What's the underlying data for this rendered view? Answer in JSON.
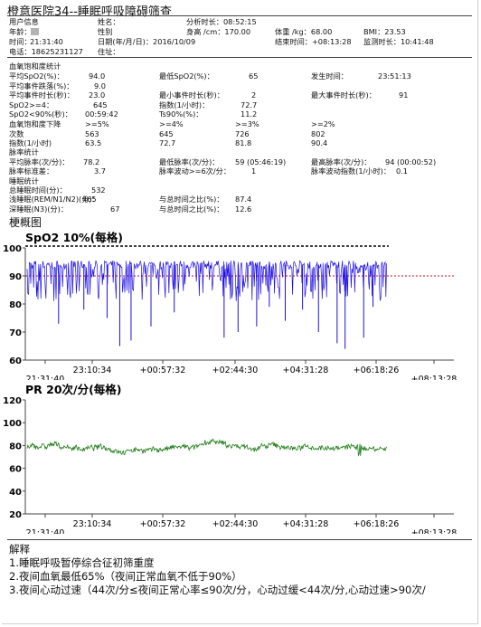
{
  "title": "橙意医院34--睡眠呼吸障碍筛查",
  "patient": {
    "user_info": "用户信息",
    "name_label": "姓名：",
    "analysis_duration": "分析时长：08:52:15",
    "age_label": "年龄：",
    "gender_label": "性别",
    "height": "身高 /cm：170.00",
    "weight": "体重 /kg：68.00",
    "bmi": "BMI：23.53",
    "time_label": "时间：",
    "time_value": "21:31:40",
    "date": "日期(年/月/日)：2016/10/09",
    "end_time": "结束时间：+08:13:28",
    "monitor_duration": "监测时长：10:41:48",
    "phone": "电话：18625231127",
    "address": "住址："
  },
  "spo2_stats": {
    "heading": "血氧饱和度统计",
    "rows": [
      {
        "label": "平均SpO2(%)：",
        "value": "94.0",
        "label2": "最低SpO2(%)：",
        "value2": "65",
        "label3": "发生时间：",
        "value3": "23:51:13"
      },
      {
        "label": "平均事件跌落(%)：",
        "value": "9.0"
      },
      {
        "label": "平均事件时长(秒)：",
        "value": "23.0",
        "label2": "最小事件时长(秒)：",
        "value2": "2",
        "label3": "最大事件时长(秒)：",
        "value3": "91"
      },
      {
        "label": "SpO2>=4：",
        "value": "645",
        "label2": "指数(1/小时)：",
        "value2": "72.7"
      },
      {
        "label": "SpO2<90%(秒)：",
        "value": "00:59:42",
        "label2": "Ts90%(%)：",
        "value2": "11.2"
      }
    ],
    "drop_table": {
      "headers": [
        "血氧饱和度下降",
        ">=5%",
        ">=4%",
        ">=3%",
        ">=2%"
      ],
      "rows": [
        [
          "次数",
          "563",
          "645",
          "726",
          "802"
        ],
        [
          "指数(1/小时)",
          "63.5",
          "72.7",
          "81.8",
          "90.4"
        ]
      ]
    }
  },
  "pulse_stats": {
    "heading": "脉率统计",
    "rows": [
      {
        "label": "平均脉率(次/分)：",
        "value": "78.2",
        "label2": "最低脉率(次/分)：",
        "value2": "59 (05:46:19)",
        "label3": "最高脉率(次/分)：",
        "value3": "94 (00:00:52)"
      },
      {
        "label": "脉率标准差：",
        "value": "3.7",
        "label2": "脉率波动>=6次/分：",
        "value2": "1",
        "label3": "脉率波动指数(1/小时)：",
        "value3": "0.1"
      }
    ]
  },
  "sleep_stats": {
    "heading": "睡眠统计",
    "rows": [
      {
        "label": "总睡眠时间(分)：",
        "value": "532"
      },
      {
        "label": "浅睡眠(REM/N1/N2)(分)：",
        "value": "465",
        "label2": "与总时间之比(%)：",
        "value2": "87.4"
      },
      {
        "label": "深睡眠(N3)(分)：",
        "value": "67",
        "label2": "与总时间之比(%)：",
        "value2": "12.6"
      }
    ]
  },
  "overview_heading": "梗概图",
  "chart_data": [
    {
      "type": "line",
      "title": "SpO2  10%(每格)",
      "ylim": [
        60,
        100
      ],
      "y_ticks": [
        "100",
        "90",
        "80",
        "70",
        "60"
      ],
      "x_tick_labels": [
        "21:31:40",
        "23:10:34",
        "+00:57:32",
        "+02:44:30",
        "+04:31:28",
        "+06:18:26",
        "+08:13:28"
      ],
      "threshold": 90,
      "baseline": 94,
      "deep_dips": [
        {
          "x": "22:19",
          "y": 73
        },
        {
          "x": "22:57",
          "y": 78
        },
        {
          "x": "23:32",
          "y": 75
        },
        {
          "x": "23:51",
          "y": 65
        },
        {
          "x": "00:08",
          "y": 67
        },
        {
          "x": "00:38",
          "y": 72
        },
        {
          "x": "01:13",
          "y": 77
        },
        {
          "x": "02:28",
          "y": 68
        },
        {
          "x": "02:49",
          "y": 70
        },
        {
          "x": "03:17",
          "y": 72
        },
        {
          "x": "03:36",
          "y": 79
        },
        {
          "x": "04:00",
          "y": 74
        },
        {
          "x": "04:26",
          "y": 78
        },
        {
          "x": "04:50",
          "y": 70
        },
        {
          "x": "05:18",
          "y": 66
        },
        {
          "x": "05:30",
          "y": 64
        },
        {
          "x": "05:58",
          "y": 68
        },
        {
          "x": "06:12",
          "y": 79
        }
      ],
      "colors": {
        "line": "#1e10e6",
        "threshold": "#d01010"
      }
    },
    {
      "type": "line",
      "title": "PR   20次/分(每格)",
      "ylim": [
        20,
        120
      ],
      "y_ticks": [
        "120",
        "100",
        "80",
        "60",
        "40",
        "20"
      ],
      "x_tick_labels": [
        "21:31:40",
        "23:10:34",
        "+00:57:32",
        "+02:44:30",
        "+04:31:28",
        "+06:18:26",
        "+08:13:28"
      ],
      "baseline": 78,
      "colors": {
        "line": "#1a7a12"
      }
    }
  ],
  "interpretation": {
    "heading": "解释",
    "lines": [
      "1.睡眠呼吸暂停综合征初筛重度",
      "2.夜间血氧最低65%（夜间正常血氧不低于90%）",
      "3.夜间心动过速（44次/分≤夜间正常心率≤90次/分，心动过缓<44次/分,心动过速>90次/"
    ]
  }
}
